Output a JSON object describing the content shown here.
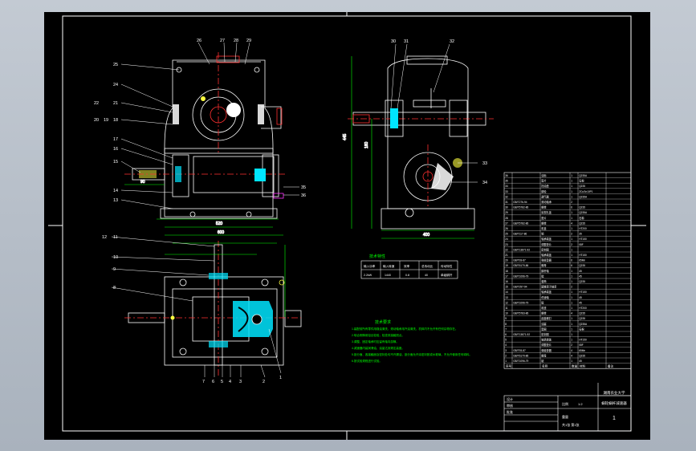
{
  "drawing": {
    "title_small": "蜗轮蜗杆减速器",
    "school": "湖南农业大学",
    "sheet_number": "1",
    "dim_height_left": "400",
    "dim_width_top_view": "600",
    "dim_base": "520",
    "dim_height_side": "445",
    "dim_shaft": "90",
    "dim_mid": "160"
  },
  "balloons": {
    "front": [
      "27",
      "26",
      "28",
      "29",
      "25",
      "24",
      "22",
      "21",
      "20",
      "19",
      "18",
      "17",
      "16",
      "15",
      "14",
      "13",
      "35",
      "36"
    ],
    "top": [
      "12",
      "11",
      "10",
      "9",
      "8",
      "7",
      "1",
      "2",
      "3",
      "4",
      "5",
      "6"
    ],
    "side": [
      "30",
      "31",
      "32",
      "33",
      "34"
    ]
  },
  "tech_spec_table": {
    "title": "技术特性",
    "headers": [
      "输入功率",
      "输入转速",
      "效率",
      "总传动比",
      "传动特性"
    ],
    "row": [
      "2.2kW",
      "1440",
      "0.8",
      "40",
      "单级蜗杆"
    ]
  },
  "tech_requirements": {
    "title": "技术要求",
    "lines": [
      "1.装配前所有零件用煤油清洗，滚动轴承用汽油清洗，机体内不允许有任何杂物存在。",
      "2.啮合侧隙用铅丝检验，检查其接触斑点。",
      "3.调整、固定轴承时应留有轴向游隙。",
      "4.减速器内装润滑油，油量达到规定高度。",
      "5.剖分面、各接触面及密封处均不许漏油，剖分面允许涂密封胶或水玻璃，不允许使用任何填料。",
      "6.按试验规程进行试验。"
    ]
  },
  "bom_rows": [
    {
      "no": "36",
      "code": "",
      "name": "油标",
      "qty": "1",
      "mat": "Q235A"
    },
    {
      "no": "35",
      "code": "",
      "name": "垫片",
      "qty": "1",
      "mat": "石棉"
    },
    {
      "no": "34",
      "code": "",
      "name": "挡油盘",
      "qty": "1",
      "mat": "Q235"
    },
    {
      "no": "33",
      "code": "",
      "name": "蜗轮",
      "qty": "1",
      "mat": "ZCuSn10P1"
    },
    {
      "no": "32",
      "code": "",
      "name": "通气器",
      "qty": "1",
      "mat": "Q235A"
    },
    {
      "no": "31",
      "code": "GB/T276-94",
      "name": "滚动轴承",
      "qty": "2",
      "mat": ""
    },
    {
      "no": "30",
      "code": "GB/T5782-86",
      "name": "螺栓",
      "qty": "6",
      "mat": "Q235"
    },
    {
      "no": "29",
      "code": "",
      "name": "窥视孔盖",
      "qty": "1",
      "mat": "Q235A"
    },
    {
      "no": "28",
      "code": "",
      "name": "垫片",
      "qty": "1",
      "mat": "石棉"
    },
    {
      "no": "27",
      "code": "GB/T5782-86",
      "name": "螺栓",
      "qty": "4",
      "mat": "Q235"
    },
    {
      "no": "26",
      "code": "",
      "name": "机盖",
      "qty": "1",
      "mat": "HT200"
    },
    {
      "no": "25",
      "code": "GB/T117-86",
      "name": "销",
      "qty": "2",
      "mat": "35"
    },
    {
      "no": "24",
      "code": "",
      "name": "轴承端盖",
      "qty": "1",
      "mat": "HT150"
    },
    {
      "no": "23",
      "code": "",
      "name": "调整垫片",
      "qty": "2",
      "mat": "08F"
    },
    {
      "no": "22",
      "code": "GB/T13871-92",
      "name": "密封圈",
      "qty": "1",
      "mat": ""
    },
    {
      "no": "21",
      "code": "",
      "name": "轴承端盖",
      "qty": "1",
      "mat": "HT150"
    },
    {
      "no": "20",
      "code": "GB/T93-87",
      "name": "弹簧垫圈",
      "qty": "6",
      "mat": "65Mn"
    },
    {
      "no": "19",
      "code": "GB/T6170-86",
      "name": "螺母",
      "qty": "6",
      "mat": "Q235"
    },
    {
      "no": "18",
      "code": "",
      "name": "蜗杆轴",
      "qty": "1",
      "mat": "45"
    },
    {
      "no": "17",
      "code": "GB/T1096-79",
      "name": "键",
      "qty": "1",
      "mat": "45"
    },
    {
      "no": "16",
      "code": "",
      "name": "套筒",
      "qty": "1",
      "mat": "Q235"
    },
    {
      "no": "15",
      "code": "GB/T297-94",
      "name": "圆锥滚子轴承",
      "qty": "2",
      "mat": ""
    },
    {
      "no": "14",
      "code": "",
      "name": "轴承端盖",
      "qty": "1",
      "mat": "HT150"
    },
    {
      "no": "13",
      "code": "",
      "name": "低速轴",
      "qty": "1",
      "mat": "45"
    },
    {
      "no": "12",
      "code": "GB/T1096-79",
      "name": "键",
      "qty": "1",
      "mat": "45"
    },
    {
      "no": "11",
      "code": "",
      "name": "机座",
      "qty": "1",
      "mat": "HT200"
    },
    {
      "no": "10",
      "code": "GB/T5783-86",
      "name": "螺栓",
      "qty": "4",
      "mat": "Q235"
    },
    {
      "no": "9",
      "code": "",
      "name": "起盖螺钉",
      "qty": "1",
      "mat": "Q235"
    },
    {
      "no": "8",
      "code": "",
      "name": "油塞",
      "qty": "1",
      "mat": "Q235A"
    },
    {
      "no": "7",
      "code": "",
      "name": "垫圈",
      "qty": "1",
      "mat": "石棉"
    },
    {
      "no": "6",
      "code": "GB/T13871-92",
      "name": "密封圈",
      "qty": "1",
      "mat": ""
    },
    {
      "no": "5",
      "code": "",
      "name": "轴承端盖",
      "qty": "1",
      "mat": "HT150"
    },
    {
      "no": "4",
      "code": "",
      "name": "调整垫片",
      "qty": "2",
      "mat": "08F"
    },
    {
      "no": "3",
      "code": "GB/T93-87",
      "name": "弹簧垫圈",
      "qty": "4",
      "mat": "65Mn"
    },
    {
      "no": "2",
      "code": "GB/T6170-86",
      "name": "螺母",
      "qty": "4",
      "mat": "Q235"
    },
    {
      "no": "1",
      "code": "GB/T1096-79",
      "name": "键",
      "qty": "1",
      "mat": "45"
    }
  ],
  "bom_header": {
    "no": "序号",
    "name": "名称",
    "qty": "数量",
    "mat": "材料",
    "note": "备注"
  },
  "title_block": {
    "designer_label": "设计",
    "checker_label": "审核",
    "approver_label": "批准",
    "scale_label": "比例",
    "scale": "1:2",
    "weight_label": "重量",
    "sheet_label": "共1张 第1张"
  },
  "colors": {
    "bg": "#000000",
    "lines": "#ffffff",
    "cyan": "#00e5ff",
    "green": "#00ff00",
    "red": "#ff3030",
    "magenta": "#ff33ff",
    "yellow": "#ffff40"
  }
}
